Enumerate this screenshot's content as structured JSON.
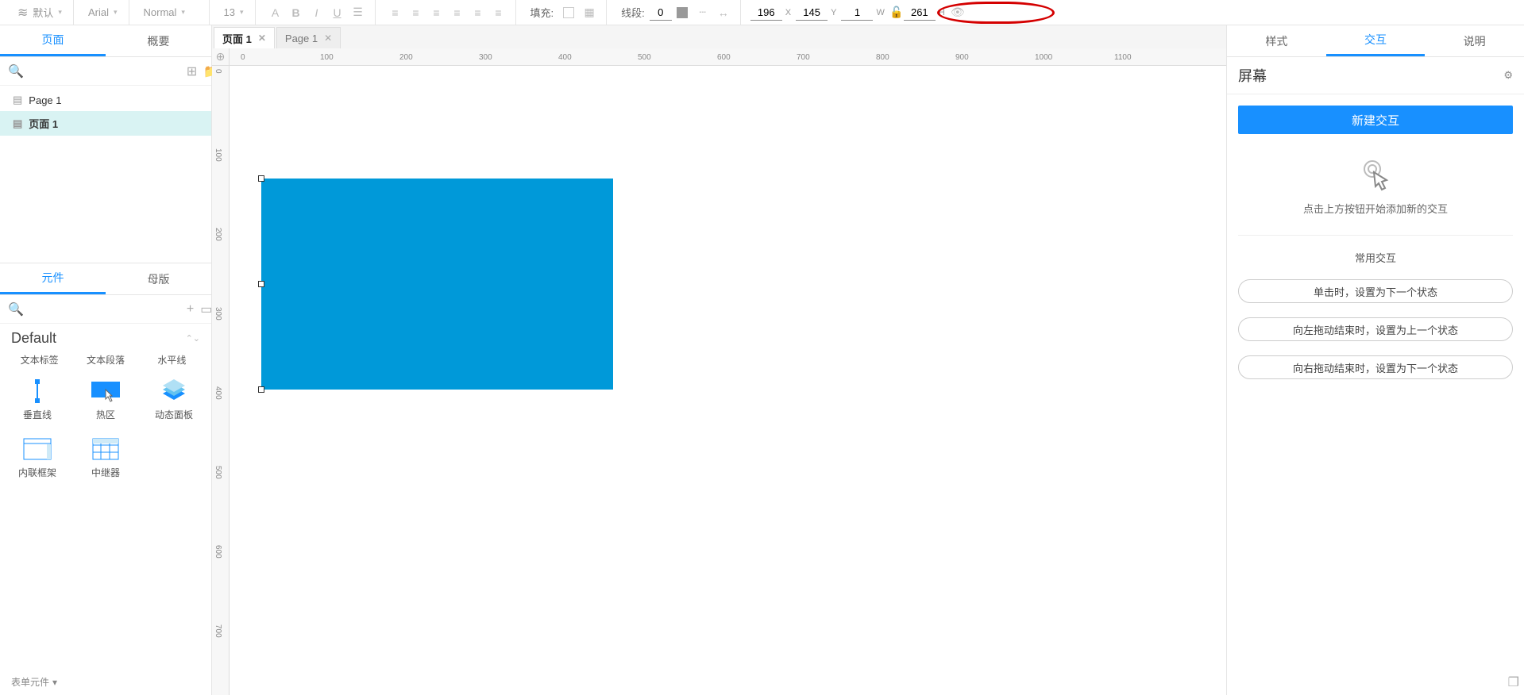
{
  "toolbar": {
    "presets": "默认",
    "font": "Arial",
    "style": "Normal",
    "size": "13",
    "fill_label": "填充:",
    "line_label": "线段:",
    "line_weight": "0",
    "x": "196",
    "y": "145",
    "w": "1",
    "h": "261"
  },
  "left": {
    "tab_pages": "页面",
    "tab_outline": "概要",
    "pages": [
      {
        "name": "Page 1",
        "selected": false
      },
      {
        "name": "页面 1",
        "selected": true
      }
    ],
    "tab_widgets": "元件",
    "tab_masters": "母版",
    "library": "Default",
    "widgets_row_labels": [
      "文本标签",
      "文本段落",
      "水平线",
      "垂直线",
      "热区",
      "动态面板",
      "内联框架",
      "中继器"
    ],
    "form_section": "表单元件"
  },
  "center": {
    "tabs": [
      {
        "label": "页面 1",
        "active": true
      },
      {
        "label": "Page 1",
        "active": false
      }
    ],
    "ruler_marks_h": [
      0,
      100,
      200,
      300,
      400,
      500,
      600,
      700,
      800,
      900,
      1000,
      1100
    ],
    "ruler_marks_v": [
      0,
      100,
      200,
      300,
      400,
      500,
      600,
      700
    ]
  },
  "right": {
    "tab_style": "样式",
    "tab_interact": "交互",
    "tab_notes": "说明",
    "header": "屏幕",
    "new_btn": "新建交互",
    "hint": "点击上方按钮开始添加新的交互",
    "common_label": "常用交互",
    "common": [
      "单击时，设置为下一个状态",
      "向左拖动结束时，设置为上一个状态",
      "向右拖动结束时，设置为下一个状态"
    ]
  }
}
